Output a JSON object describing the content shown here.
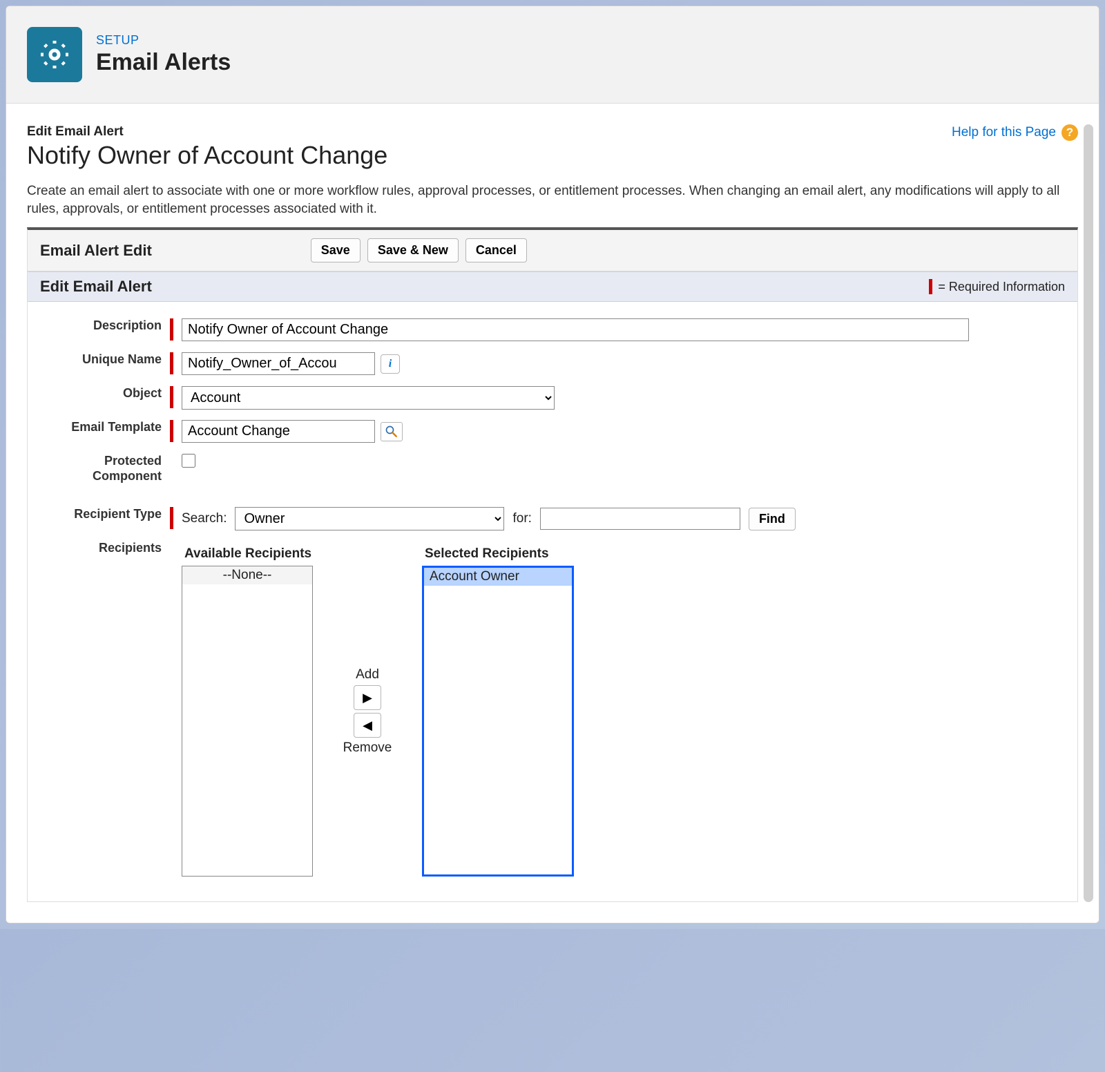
{
  "header": {
    "breadcrumb": "SETUP",
    "title": "Email Alerts"
  },
  "help": {
    "label": "Help for this Page",
    "icon_glyph": "?"
  },
  "page": {
    "edit_label": "Edit Email Alert",
    "title": "Notify Owner of Account Change",
    "intro": "Create an email alert to associate with one or more workflow rules, approval processes, or entitlement processes. When changing an email alert, any modifications will apply to all rules, approvals, or entitlement processes associated with it."
  },
  "toolbar": {
    "title": "Email Alert Edit",
    "save_label": "Save",
    "save_new_label": "Save & New",
    "cancel_label": "Cancel"
  },
  "section": {
    "title": "Edit Email Alert",
    "required_legend": "= Required Information"
  },
  "fields": {
    "description_label": "Description",
    "description_value": "Notify Owner of Account Change",
    "unique_name_label": "Unique Name",
    "unique_name_value": "Notify_Owner_of_Accou",
    "info_glyph": "i",
    "object_label": "Object",
    "object_value": "Account",
    "email_template_label": "Email Template",
    "email_template_value": "Account Change",
    "protected_label": "Protected Component",
    "protected_checked": false,
    "recipient_type_label": "Recipient Type",
    "recipients_label": "Recipients",
    "search_label": "Search:",
    "search_value": "Owner",
    "for_label": "for:",
    "for_value": "",
    "find_label": "Find"
  },
  "dual_list": {
    "available_title": "Available Recipients",
    "available_items": [
      "--None--"
    ],
    "selected_title": "Selected Recipients",
    "selected_items": [
      "Account Owner"
    ],
    "add_label": "Add",
    "remove_label": "Remove"
  }
}
